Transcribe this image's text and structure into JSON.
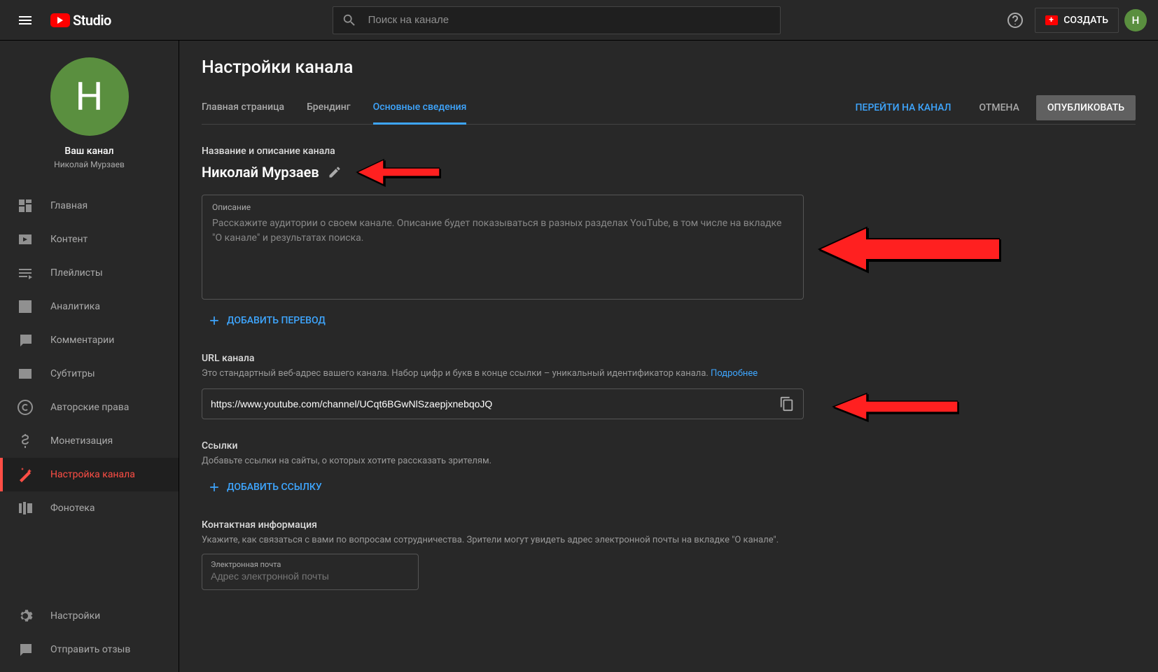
{
  "header": {
    "logo_text": "Studio",
    "search_placeholder": "Поиск на канале",
    "create_label": "СОЗДАТЬ",
    "avatar_letter": "Н"
  },
  "sidebar": {
    "avatar_letter": "Н",
    "your_channel": "Ваш канал",
    "owner_name": "Николай Мурзаев",
    "items": [
      {
        "label": "Главная"
      },
      {
        "label": "Контент"
      },
      {
        "label": "Плейлисты"
      },
      {
        "label": "Аналитика"
      },
      {
        "label": "Комментарии"
      },
      {
        "label": "Субтитры"
      },
      {
        "label": "Авторские права"
      },
      {
        "label": "Монетизация"
      },
      {
        "label": "Настройка канала"
      },
      {
        "label": "Фонотека"
      }
    ],
    "bottom": [
      {
        "label": "Настройки"
      },
      {
        "label": "Отправить отзыв"
      }
    ]
  },
  "page": {
    "title": "Настройки канала",
    "tabs": [
      {
        "label": "Главная страница"
      },
      {
        "label": "Брендинг"
      },
      {
        "label": "Основные сведения"
      }
    ],
    "actions": {
      "goto_channel": "ПЕРЕЙТИ НА КАНАЛ",
      "cancel": "ОТМЕНА",
      "publish": "ОПУБЛИКОВАТЬ"
    },
    "name_section": {
      "label": "Название и описание канала",
      "channel_name": "Николай Мурзаев",
      "desc_label": "Описание",
      "desc_placeholder": "Расскажите аудитории о своем канале. Описание будет показываться в разных разделах YouTube, в том числе на вкладке \"О канале\" и результатах поиска.",
      "add_translation": "ДОБАВИТЬ ПЕРЕВОД"
    },
    "url_section": {
      "label": "URL канала",
      "hint": "Это стандартный веб-адрес вашего канала. Набор цифр и букв в конце ссылки – уникальный идентификатор канала. ",
      "learn_more": "Подробнее",
      "url_value": "https://www.youtube.com/channel/UCqt6BGwNlSzaepjxnebqoJQ"
    },
    "links_section": {
      "label": "Ссылки",
      "hint": "Добавьте ссылки на сайты, о которых хотите рассказать зрителям.",
      "add_link": "ДОБАВИТЬ ССЫЛКУ"
    },
    "contact_section": {
      "label": "Контактная информация",
      "hint": "Укажите, как связаться с вами по вопросам сотрудничества. Зрители могут увидеть адрес электронной почты на вкладке \"О канале\".",
      "email_label": "Электронная почта",
      "email_placeholder": "Адрес электронной почты"
    }
  }
}
